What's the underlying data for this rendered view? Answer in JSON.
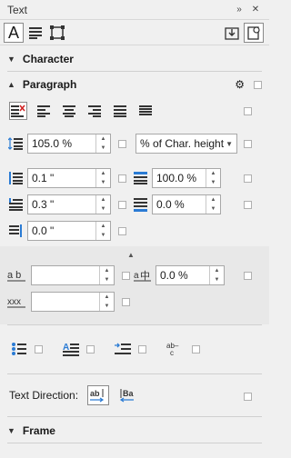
{
  "panel": {
    "title": "Text"
  },
  "sections": {
    "character": "Character",
    "paragraph": "Paragraph",
    "frame": "Frame"
  },
  "paragraph": {
    "line_spacing": "105.0 %",
    "line_spacing_unit": "% of Char. height",
    "left_indent": "0.1 \"",
    "first_line_indent": "0.3 \"",
    "right_indent": "0.0 \"",
    "before_para": "100.0 %",
    "after_para": "0.0 %",
    "char_spacing": "",
    "language_spacing": "0.0 %",
    "word_spacing": "",
    "text_direction_label": "Text Direction:"
  }
}
